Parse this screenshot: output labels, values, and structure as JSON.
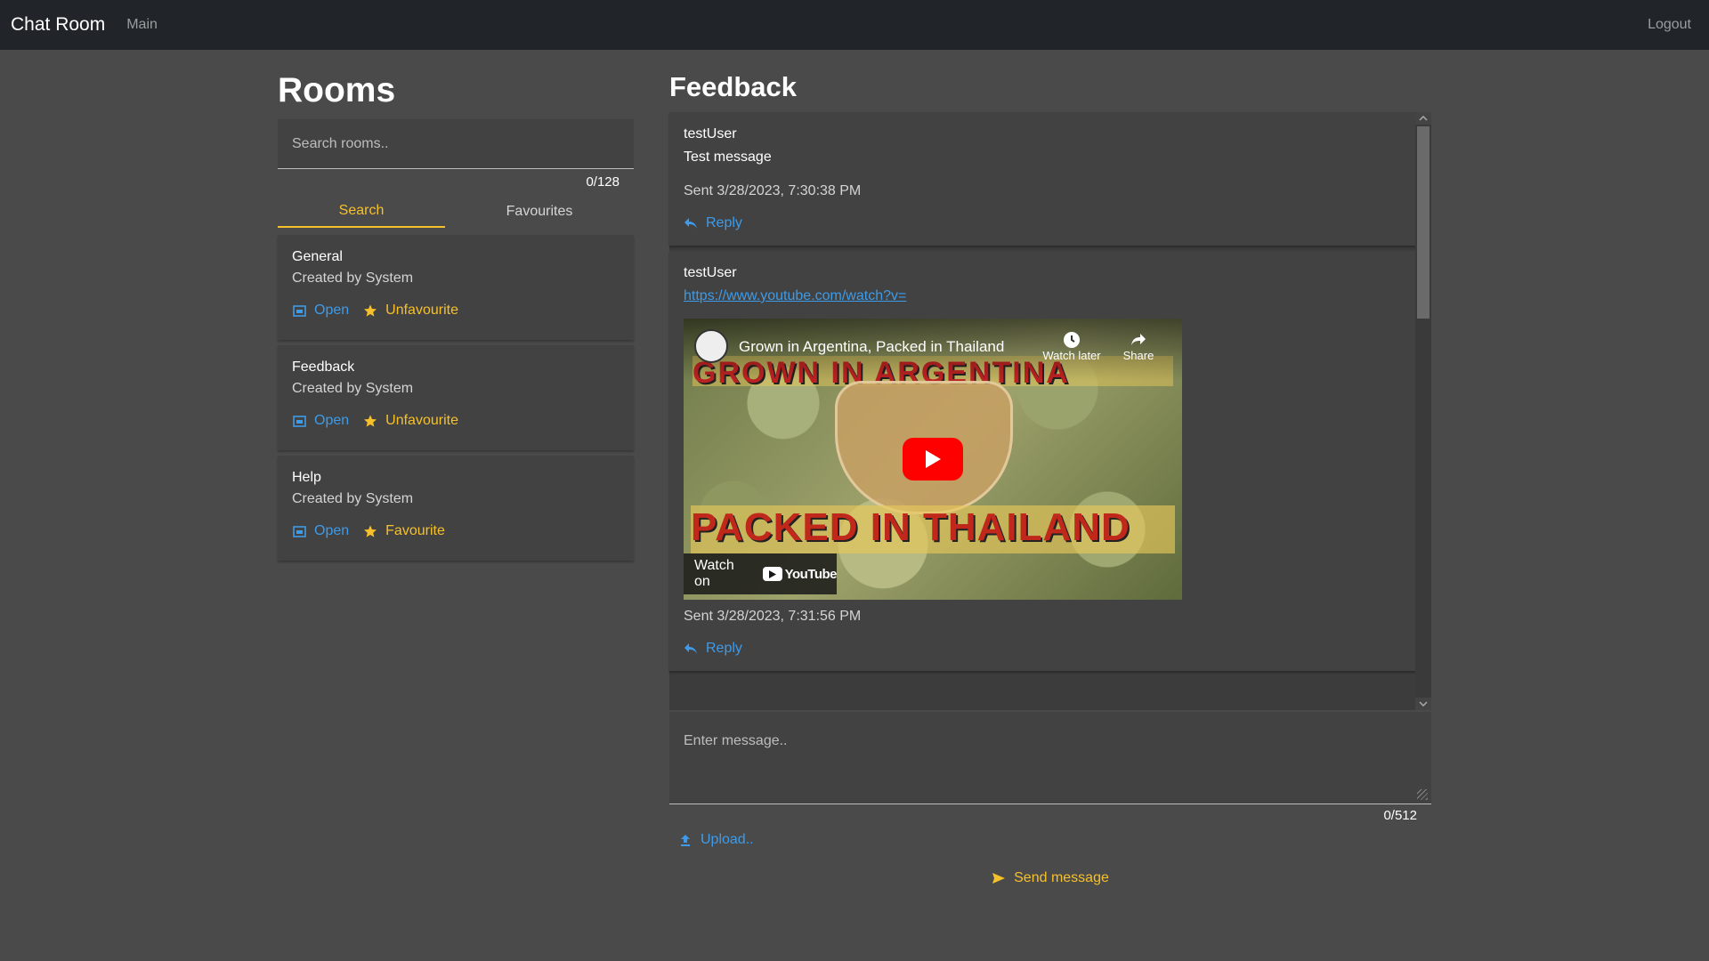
{
  "navbar": {
    "brand": "Chat Room",
    "main_link": "Main",
    "logout": "Logout"
  },
  "rooms": {
    "title": "Rooms",
    "search_placeholder": "Search rooms..",
    "counter": "0/128",
    "tabs": [
      {
        "label": "Search",
        "active": true
      },
      {
        "label": "Favourites",
        "active": false
      }
    ],
    "items": [
      {
        "name": "General",
        "creator": "Created by System",
        "open_label": "Open",
        "fav_label": "Unfavourite"
      },
      {
        "name": "Feedback",
        "creator": "Created by System",
        "open_label": "Open",
        "fav_label": "Unfavourite"
      },
      {
        "name": "Help",
        "creator": "Created by System",
        "open_label": "Open",
        "fav_label": "Favourite"
      }
    ]
  },
  "chat": {
    "title": "Feedback",
    "messages": [
      {
        "user": "testUser",
        "text": "Test message",
        "sent": "Sent 3/28/2023, 7:30:38 PM",
        "reply_label": "Reply"
      },
      {
        "user": "testUser",
        "link": "https://www.youtube.com/watch?v=",
        "sent": "Sent 3/28/2023, 7:31:56 PM",
        "reply_label": "Reply",
        "video": {
          "title": "Grown in Argentina, Packed in Thailand",
          "watch_later": "Watch later",
          "share": "Share",
          "watch_on": "Watch on",
          "yt": "YouTube",
          "banner_top": "GROWN IN ARGENTINA",
          "banner_bottom": "PACKED IN THAILAND"
        }
      }
    ],
    "composer_placeholder": "Enter message..",
    "counter": "0/512",
    "upload_label": "Upload..",
    "send_label": "Send message"
  },
  "colors": {
    "accent": "#f6c02b",
    "link": "#3d9be9",
    "navbar": "#212529",
    "background": "#4a4a4a",
    "card": "#424242"
  }
}
